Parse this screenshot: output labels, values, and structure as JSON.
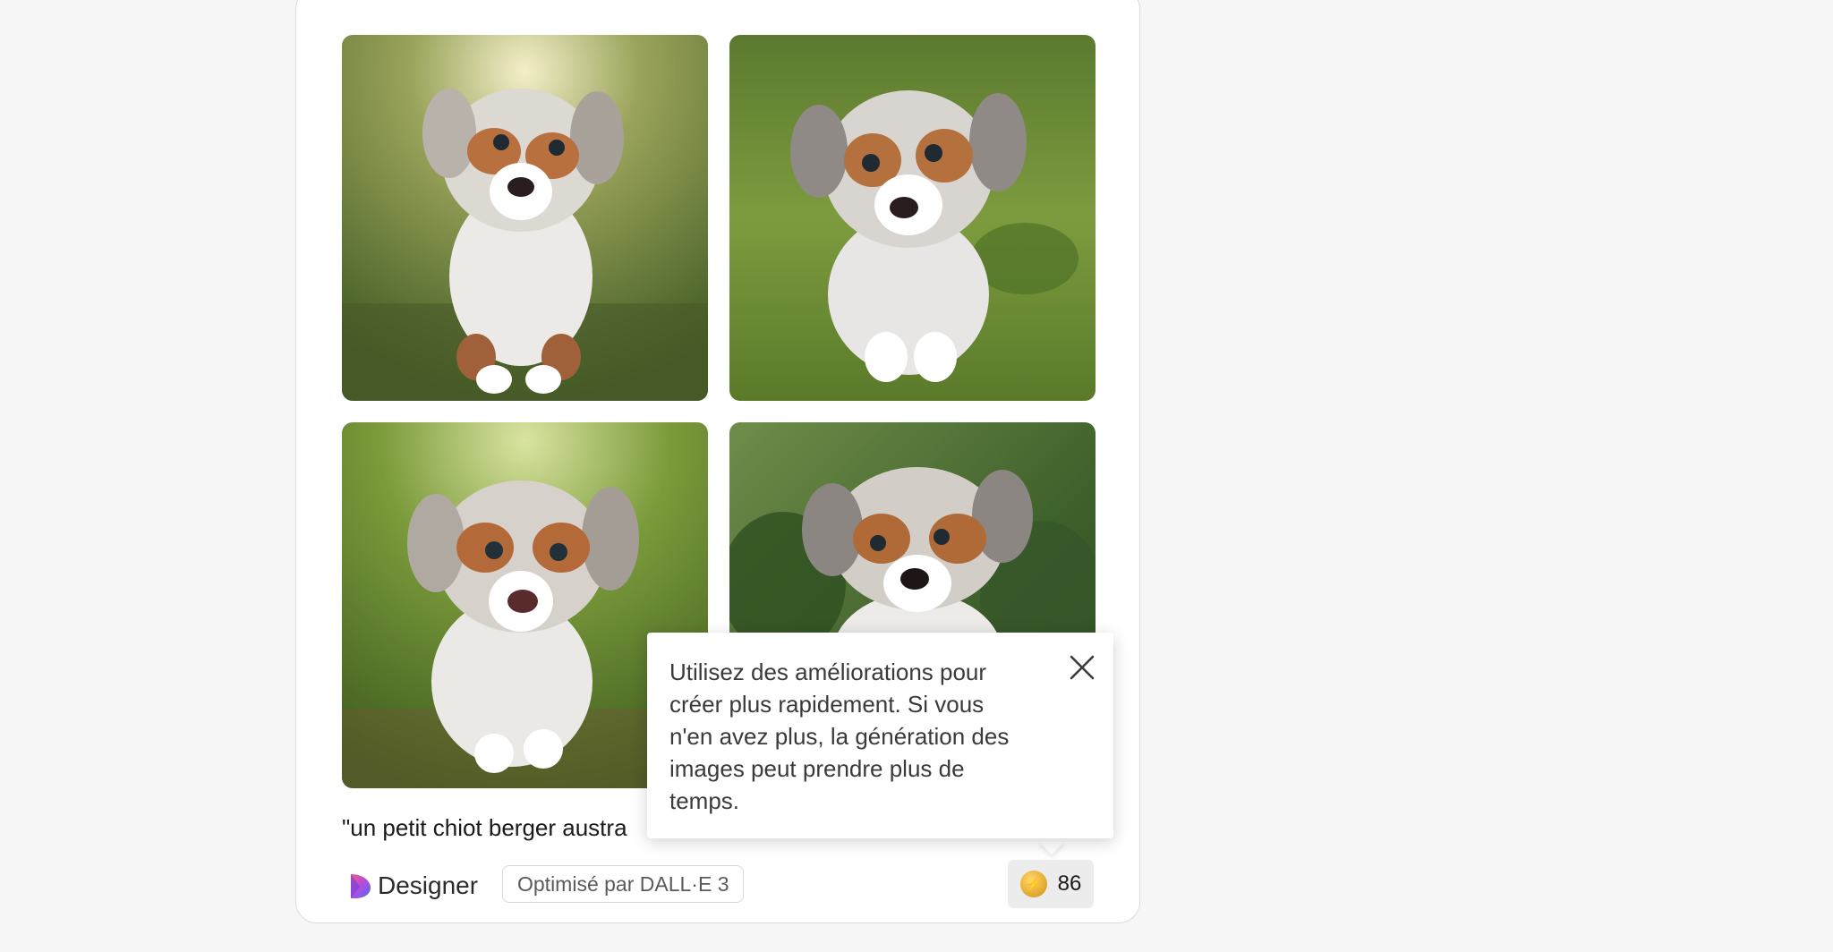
{
  "images": [
    {
      "alt": "chiot 1"
    },
    {
      "alt": "chiot 2"
    },
    {
      "alt": "chiot 3"
    },
    {
      "alt": "chiot 4"
    }
  ],
  "prompt_text": "\"un petit chiot berger austra",
  "footer": {
    "brand_label": "Designer",
    "powered_by": "Optimisé par DALL·E 3",
    "boost_count": "86"
  },
  "tooltip": {
    "text": "Utilisez des améliorations pour créer plus rapidement. Si vous n'en avez plus, la génération des images peut prendre plus de temps."
  },
  "colors": {
    "page_bg": "#f6f6f6",
    "card_bg": "#ffffff",
    "coin": "#e2a52a"
  }
}
